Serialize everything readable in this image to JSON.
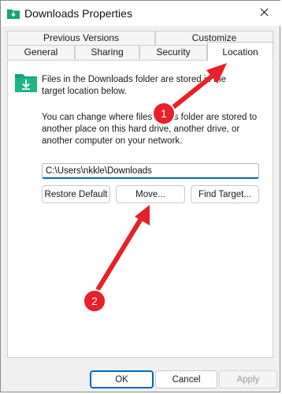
{
  "window": {
    "title": "Downloads Properties"
  },
  "tabs": {
    "row1": [
      "Previous Versions",
      "Customize"
    ],
    "row2": [
      "General",
      "Sharing",
      "Security",
      "Location"
    ],
    "active": "Location"
  },
  "location": {
    "description": "Files in the Downloads folder are stored in the target location below.",
    "change_text": "You can change where files in this folder are stored to another place on this hard drive, another drive, or another computer on your network.",
    "path_value": "C:\\Users\\nkkle\\Downloads",
    "buttons": {
      "restore_default": "Restore Default",
      "move": "Move...",
      "find_target": "Find Target..."
    }
  },
  "footer": {
    "ok": "OK",
    "cancel": "Cancel",
    "apply": "Apply"
  },
  "annotations": {
    "badge1": "1",
    "badge2": "2",
    "color": "#e8202a"
  },
  "icons": [
    "downloads-folder-icon",
    "close-icon"
  ]
}
